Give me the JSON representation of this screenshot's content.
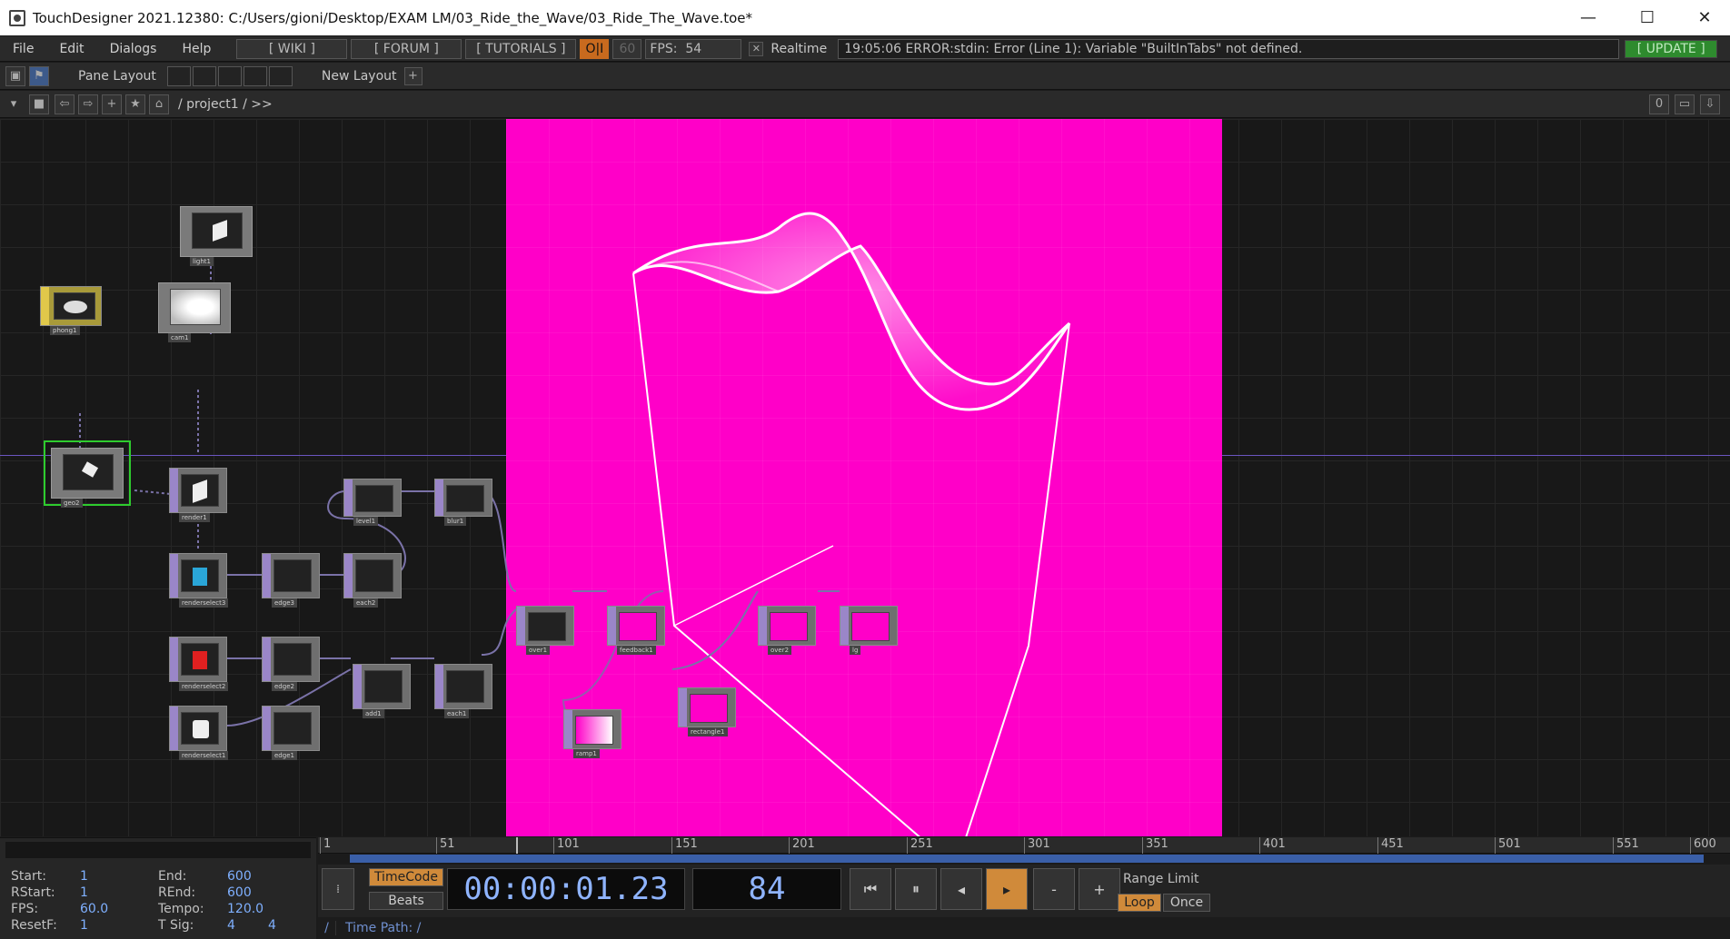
{
  "title": "TouchDesigner 2021.12380: C:/Users/gioni/Desktop/EXAM LM/03_Ride_the_Wave/03_Ride_The_Wave.toe*",
  "menu": [
    "File",
    "Edit",
    "Dialogs",
    "Help"
  ],
  "header": {
    "wiki": "[ WIKI ]",
    "forum": "[ FORUM ]",
    "tutorials": "[ TUTORIALS ]",
    "oi": "O|I",
    "fps_cap": "60",
    "fps_label": "FPS:",
    "fps_value": "54",
    "realtime": "Realtime",
    "error": "19:05:06 ERROR:stdin: Error (Line 1): Variable \"BuiltInTabs\" not defined.",
    "update": "[ UPDATE ]"
  },
  "panebar": {
    "pane_layout": "Pane Layout",
    "new_layout": "New Layout",
    "plus": "+"
  },
  "pathbar": {
    "path": "/ project1 / >>",
    "zero": "0"
  },
  "nodes": [
    {
      "label": "light1"
    },
    {
      "label": "phong1"
    },
    {
      "label": "cam1"
    },
    {
      "label": "geo2"
    },
    {
      "label": "render1"
    },
    {
      "label": "level1"
    },
    {
      "label": "blur1"
    },
    {
      "label": "renderselect3"
    },
    {
      "label": "edge3"
    },
    {
      "label": "each2"
    },
    {
      "label": "over1"
    },
    {
      "label": "feedback1"
    },
    {
      "label": "over2"
    },
    {
      "label": "lg"
    },
    {
      "label": "renderselect2"
    },
    {
      "label": "edge2"
    },
    {
      "label": "add1"
    },
    {
      "label": "each1"
    },
    {
      "label": "rectangle1"
    },
    {
      "label": "renderselect1"
    },
    {
      "label": "edge1"
    },
    {
      "label": "ramp1"
    }
  ],
  "timeline": {
    "start_label": "Start:",
    "start": "1",
    "end_label": "End:",
    "end": "600",
    "rstart_label": "RStart:",
    "rstart": "1",
    "rend_label": "REnd:",
    "rend": "600",
    "fps_label": "FPS:",
    "fps": "60.0",
    "tempo_label": "Tempo:",
    "tempo": "120.0",
    "resetf_label": "ResetF:",
    "resetf": "1",
    "tsig_label": "T Sig:",
    "tsig_a": "4",
    "tsig_b": "4",
    "ticks": [
      "1",
      "51",
      "101",
      "151",
      "201",
      "251",
      "301",
      "351",
      "401",
      "451",
      "501",
      "551",
      "600"
    ],
    "timecode_btn": "TimeCode",
    "beats_btn": "Beats",
    "timecode": "00:00:01.23",
    "frame": "84",
    "minus": "-",
    "plus": "+",
    "range_limit": "Range Limit",
    "loop": "Loop",
    "once": "Once",
    "timepath": "Time Path: /",
    "slash": "/",
    "play_position": 0.14
  },
  "colors": {
    "viewer_bg": "#ff00c8",
    "accent_orange": "#c86a1e",
    "update_green": "#2e8b2e",
    "selection_green": "#2ecc2e"
  }
}
